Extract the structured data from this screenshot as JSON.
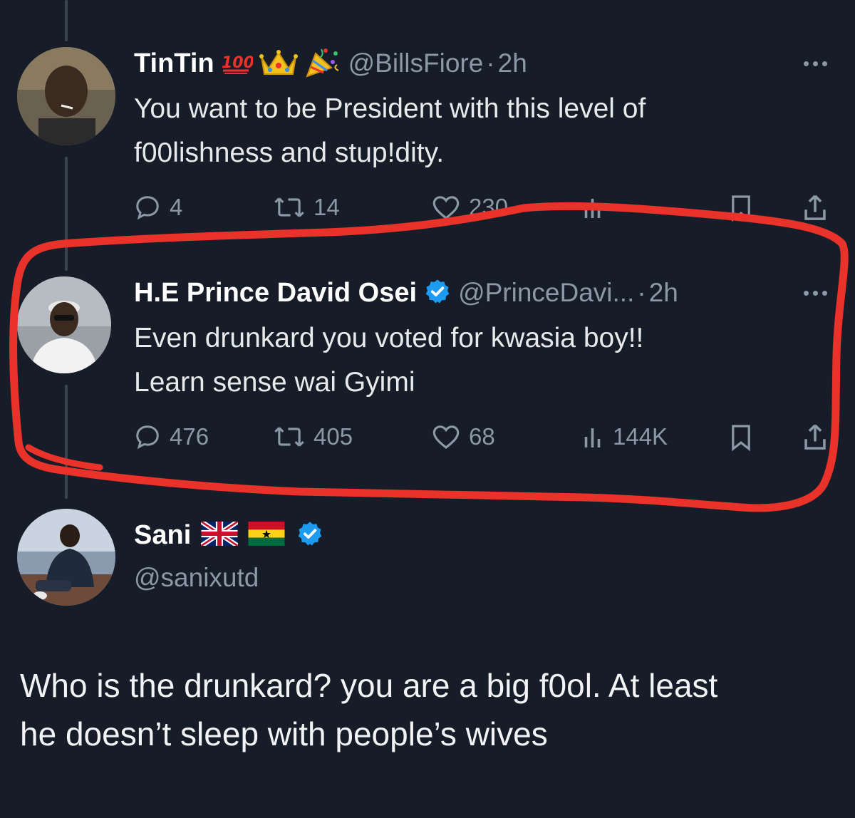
{
  "tweets": [
    {
      "name": "TinTin",
      "emoji_icons": [
        "hundred-points-icon",
        "crown-icon",
        "party-popper-icon"
      ],
      "handle": "@BillsFiore",
      "time": "2h",
      "text_lines": [
        "You want to be President with this level of",
        "f00lishness and stup!dity."
      ],
      "replies": "4",
      "reposts": "14",
      "likes": "230"
    },
    {
      "name": "H.E Prince David Osei",
      "handle": "@PrinceDavi...",
      "time": "2h",
      "text_lines": [
        "Even drunkard you voted for kwasia boy!!",
        "Learn sense wai Gyimi"
      ],
      "replies": "476",
      "reposts": "405",
      "likes": "68",
      "views": "144K"
    },
    {
      "name": "Sani",
      "handle": "@sanixutd",
      "flags": [
        "uk-flag-icon",
        "ghana-flag-icon"
      ]
    }
  ],
  "reply": {
    "text_lines": [
      "Who is the drunkard? you are a big f0ol. At least",
      "he doesn’t sleep with people’s wives"
    ]
  },
  "colors": {
    "background": "#171d28",
    "highlight": "#e8322a",
    "verified": "#1d9bf0",
    "muted": "#8b98a5"
  }
}
